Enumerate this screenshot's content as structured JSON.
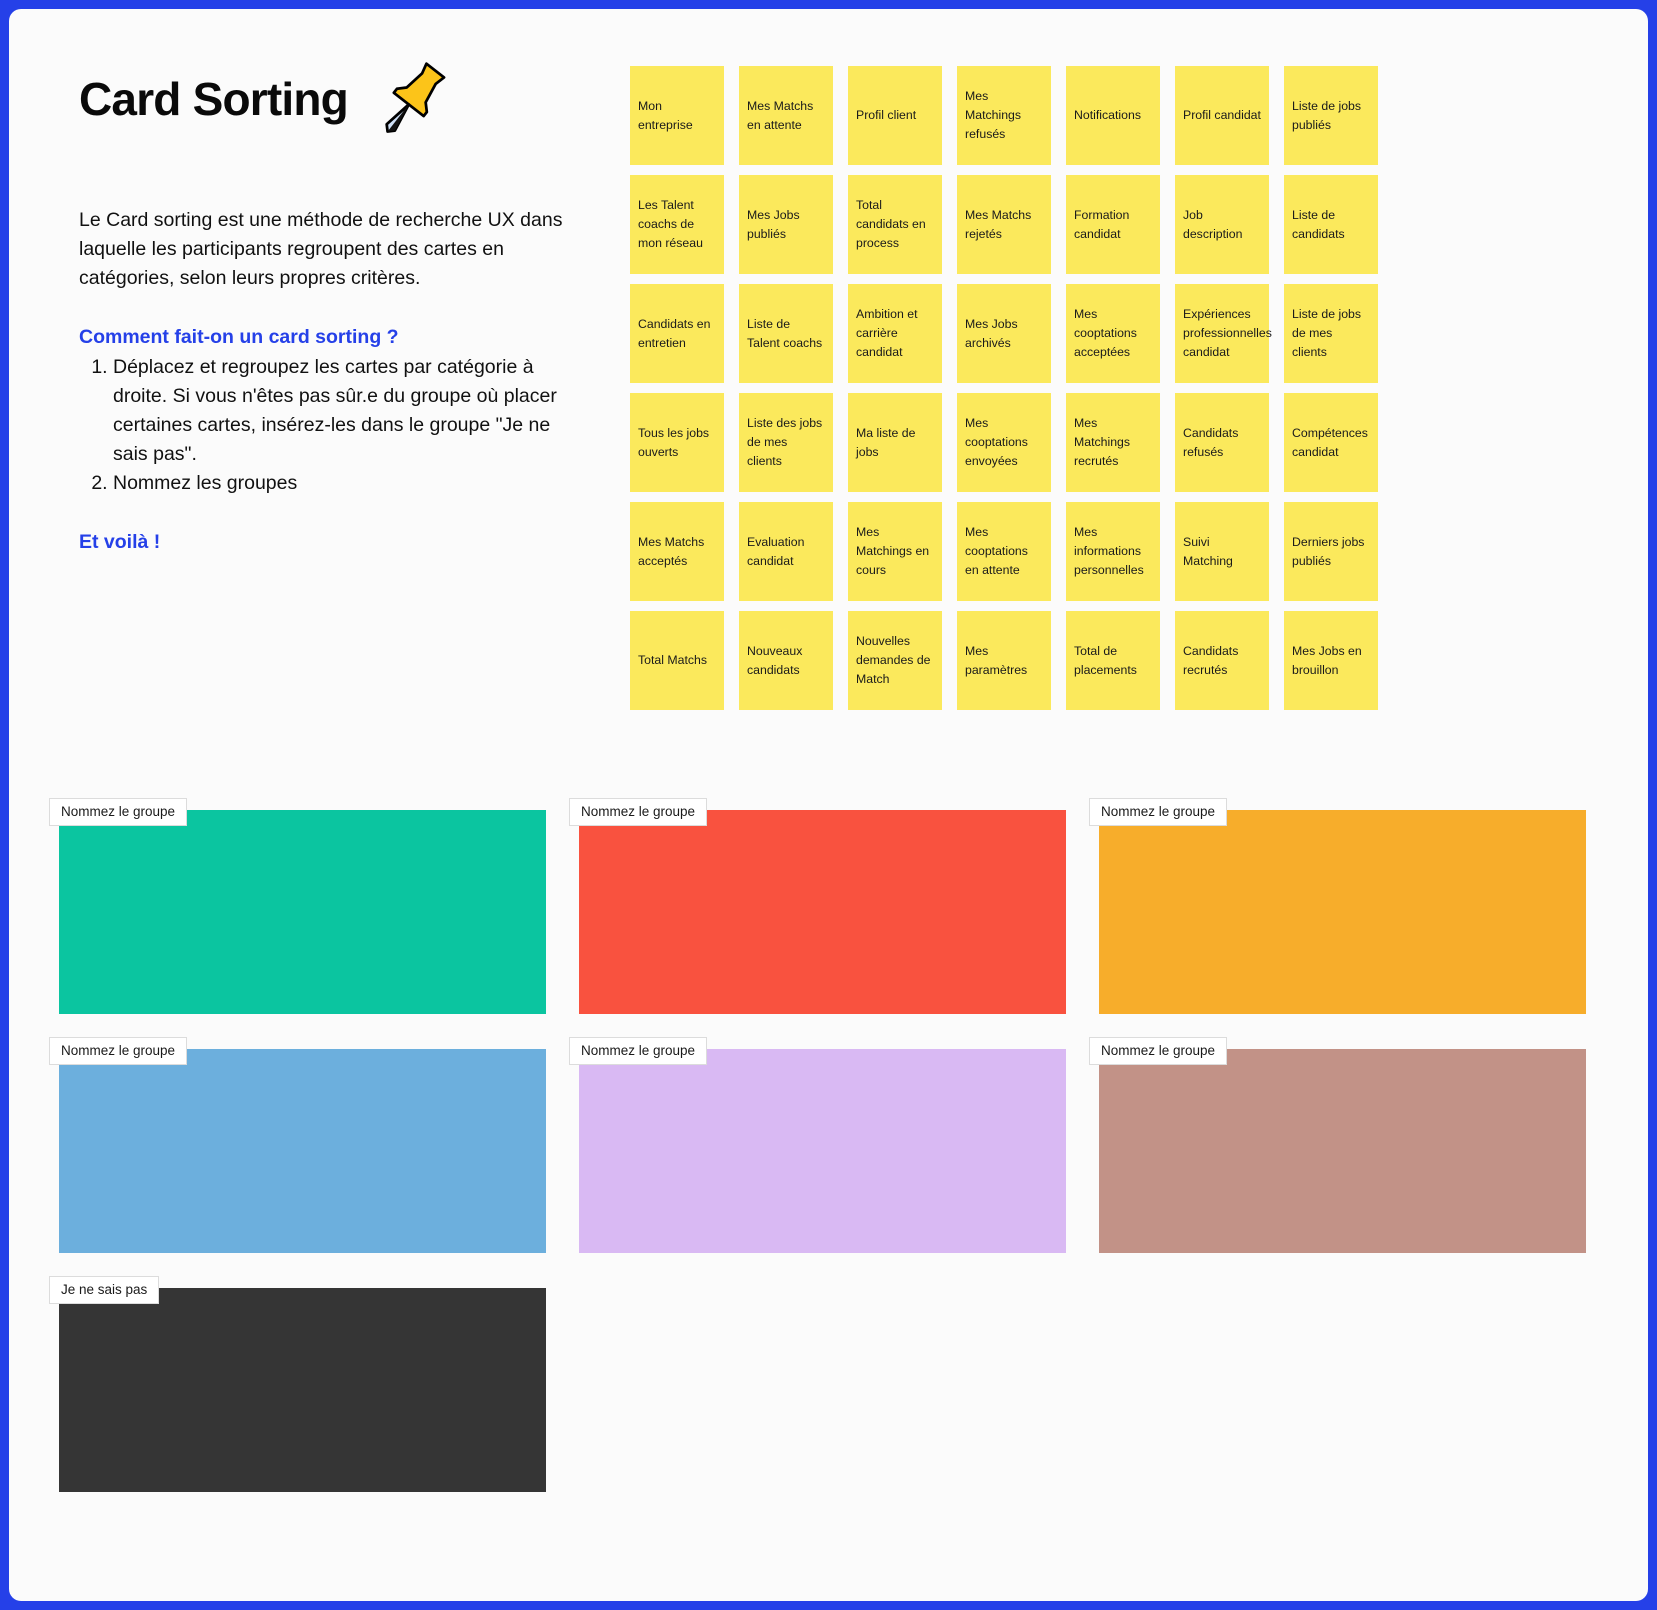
{
  "header": {
    "title": "Card Sorting",
    "pin_icon": "pushpin-icon"
  },
  "intro": {
    "paragraph": "Le Card sorting est une méthode de recherche UX dans laquelle les participants regroupent des cartes en catégories, selon leurs propres critères.",
    "howto_heading": "Comment fait-on un card sorting ?",
    "steps": [
      "Déplacez et regroupez les cartes par catégorie à droite. Si vous n'êtes pas sûr.e du groupe où placer certaines cartes, insérez-les dans le groupe \"Je ne sais pas\".",
      "Nommez les groupes"
    ],
    "closing": "Et voilà !"
  },
  "cards": [
    "Mon entreprise",
    "Mes Matchs en attente",
    "Profil client",
    "Mes Matchings refusés",
    "Notifications",
    "Profil candidat",
    "Liste de jobs publiés",
    "Les Talent coachs de mon réseau",
    "Mes Jobs publiés",
    "Total candidats en process",
    "Mes Matchs rejetés",
    "Formation candidat",
    "Job description",
    "Liste de candidats",
    "Candidats en entretien",
    "Liste de Talent coachs",
    "Ambition et carrière candidat",
    "Mes Jobs archivés",
    "Mes cooptations acceptées",
    "Expériences professionnelles candidat",
    "Liste de jobs de mes clients",
    "Tous les jobs ouverts",
    "Liste des jobs de mes clients",
    "Ma liste de jobs",
    "Mes cooptations envoyées",
    "Mes Matchings recrutés",
    "Candidats refusés",
    "Compétences candidat",
    "Mes Matchs acceptés",
    "Evaluation candidat",
    "Mes Matchings en cours",
    "Mes cooptations en attente",
    "Mes informations personnelles",
    "Suivi Matching",
    "Derniers jobs publiés",
    "Total Matchs",
    "Nouveaux candidats",
    "Nouvelles demandes de Match",
    "Mes paramètres",
    "Total de placements",
    "Candidats recrutés",
    "Mes Jobs en brouillon"
  ],
  "groups": [
    {
      "label": "Nommez le groupe",
      "color": "#0bc5a0",
      "variant": "g-green"
    },
    {
      "label": "Nommez le groupe",
      "color": "#f9523f",
      "variant": "g-red"
    },
    {
      "label": "Nommez le groupe",
      "color": "#f7ad2b",
      "variant": "g-orange"
    },
    {
      "label": "Nommez le groupe",
      "color": "#6cafdd",
      "variant": "g-blue"
    },
    {
      "label": "Nommez le groupe",
      "color": "#d9b9f3",
      "variant": "g-purple"
    },
    {
      "label": "Nommez le groupe",
      "color": "#c29287",
      "variant": "g-brown"
    },
    {
      "label": "Je ne sais pas",
      "color": "#353535",
      "variant": "g-dark"
    }
  ],
  "colors": {
    "frame_border": "#2540e8",
    "accent_blue": "#2540e8",
    "card_yellow": "#fbe95c",
    "page_background": "#fbfbfb"
  }
}
